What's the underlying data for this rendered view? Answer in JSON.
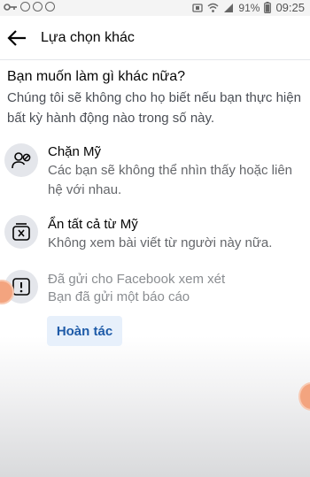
{
  "status_bar": {
    "battery_percent": "91%",
    "time": "09:25",
    "icons": [
      "key-icon",
      "circle-icon",
      "circle-icon",
      "circle-icon",
      "sim-icon",
      "wifi-icon",
      "signal-icon",
      "battery-icon"
    ]
  },
  "app_bar": {
    "title": "Lựa chọn khác"
  },
  "main": {
    "heading": "Bạn muốn làm gì khác nữa?",
    "subheading": "Chúng tôi sẽ không cho họ biết nếu bạn thực hiện bất kỳ hành động nào trong số này.",
    "options": [
      {
        "icon": "block-user-icon",
        "title": "Chặn Mỹ",
        "description": "Các bạn sẽ không thể nhìn thấy hoặc liên hệ với nhau."
      },
      {
        "icon": "hide-all-icon",
        "title": "Ẩn tất cả từ Mỹ",
        "description": "Không xem bài viết từ người này nữa."
      },
      {
        "icon": "report-icon",
        "title": "Đã gửi cho Facebook xem xét",
        "description": "Bạn đã gửi một báo cáo"
      }
    ],
    "undo_label": "Hoàn tác"
  },
  "colors": {
    "accent": "#1e5ba8",
    "undo_background": "#e7f0fb",
    "icon_circle": "#e4e6eb",
    "floating_bubble": "#f3a47f"
  }
}
